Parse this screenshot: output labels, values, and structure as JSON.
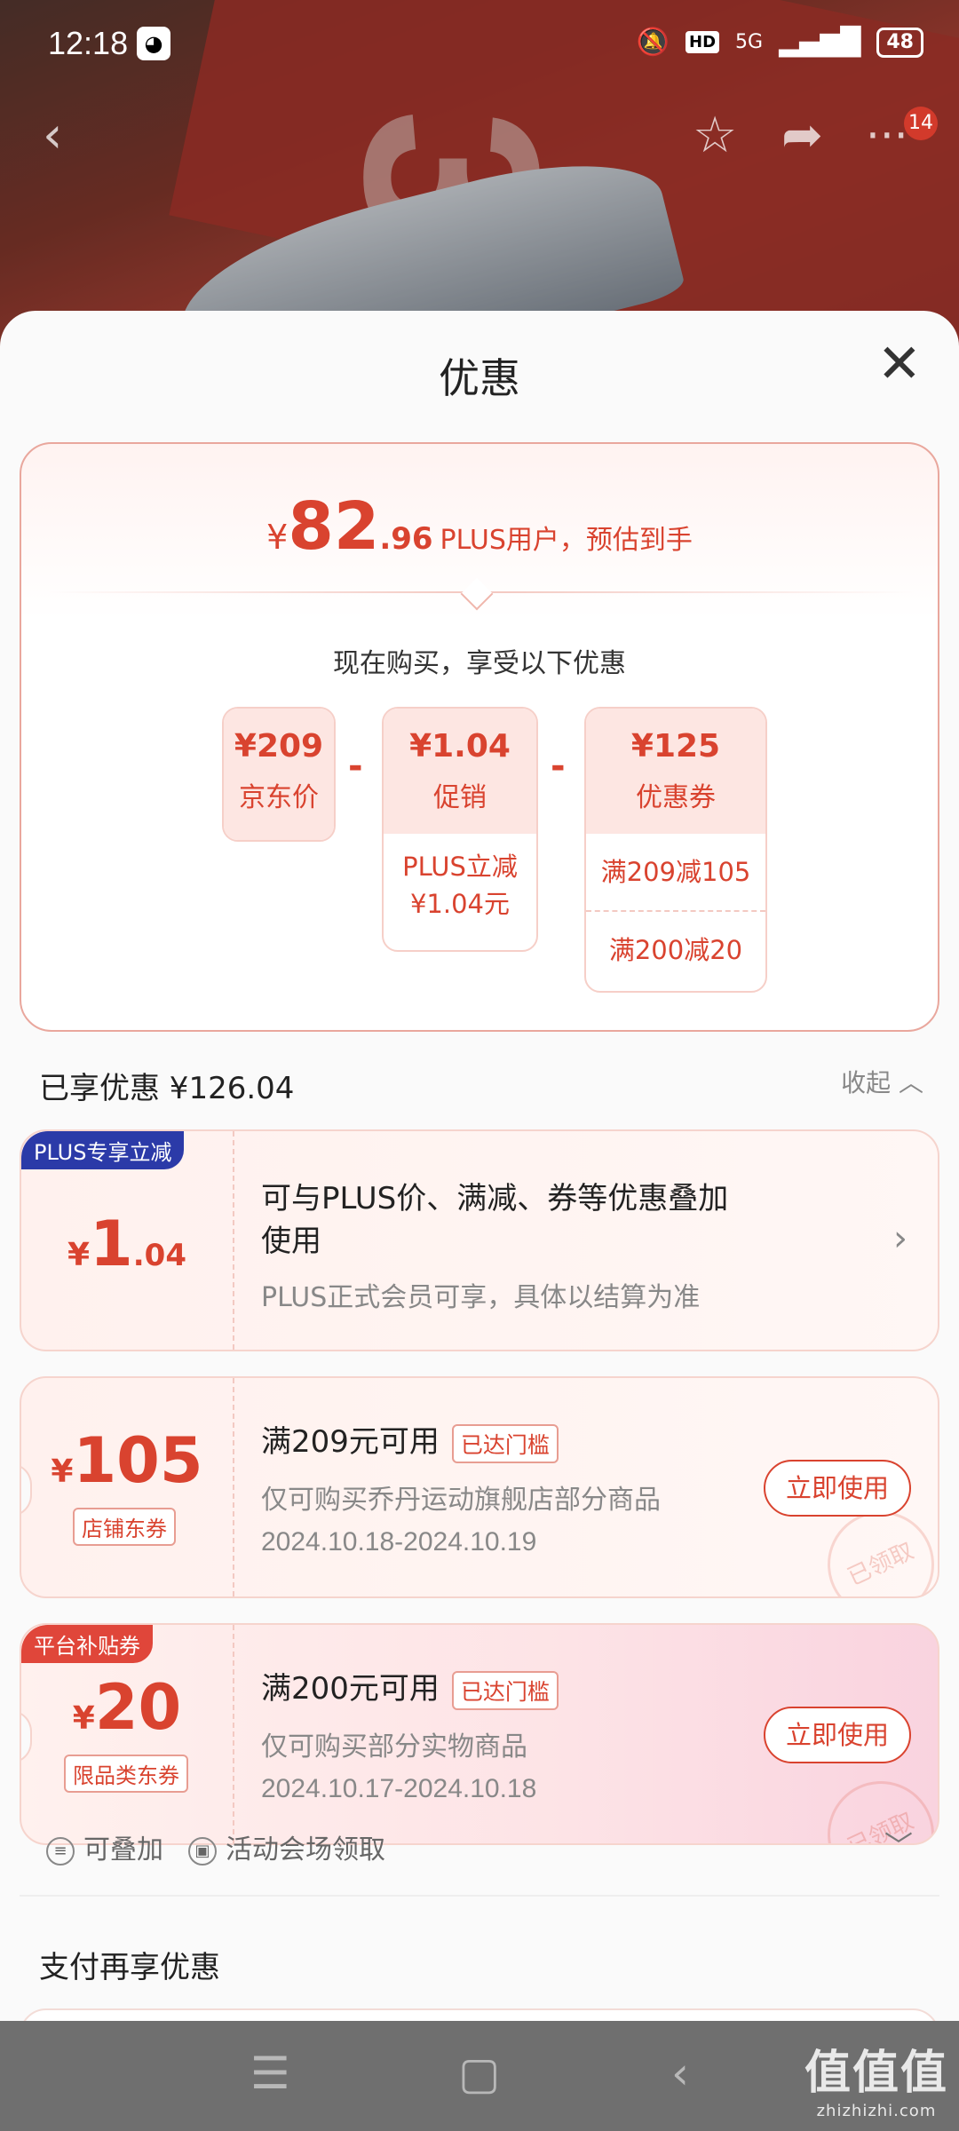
{
  "status_bar": {
    "time": "12:18",
    "hd": "HD",
    "network": "5G",
    "battery": "48"
  },
  "nav": {
    "badge": "14"
  },
  "sheet": {
    "title": "优惠"
  },
  "summary": {
    "yen": "¥",
    "price_int": "82",
    "price_dec": ".96",
    "note": "PLUS用户，预估到手",
    "subtitle": "现在购买，享受以下优惠",
    "jd_price": {
      "price": "¥209",
      "label": "京东价"
    },
    "promo": {
      "price": "¥1.04",
      "label": "促销",
      "detail_line1": "PLUS立减",
      "detail_line2": "¥1.04元"
    },
    "coupon": {
      "price": "¥125",
      "label": "优惠券",
      "rows": [
        "满209减105",
        "满200减20"
      ]
    },
    "op1": "-",
    "op2": "-"
  },
  "enjoyed": {
    "text": "已享优惠 ¥126.04",
    "collapse": "收起"
  },
  "coupons": [
    {
      "corner_tag": "PLUS专享立减",
      "yen": "¥",
      "amount": "1",
      "amount_dec": ".04",
      "title_line1": "可与PLUS价、满减、券等优惠叠加",
      "title_line2": "使用",
      "sub": "PLUS正式会员可享，具体以结算为准"
    },
    {
      "yen": "¥",
      "amount": "105",
      "tag": "店铺东券",
      "title": "满209元可用",
      "badge": "已达门槛",
      "sub": "仅可购买乔丹运动旗舰店部分商品",
      "date": "2024.10.18-2024.10.19",
      "button": "立即使用",
      "stamp": "已领取"
    },
    {
      "corner_tag": "平台补贴券",
      "yen": "¥",
      "amount": "20",
      "tag": "限品类东券",
      "title": "满200元可用",
      "badge": "已达门槛",
      "sub": "仅可购买部分实物商品",
      "date": "2024.10.17-2024.10.18",
      "button": "立即使用",
      "stamp": "已领取"
    }
  ],
  "extra": {
    "stackable": "可叠加",
    "venue": "活动会场领取"
  },
  "pay": {
    "title": "支付再享优惠"
  },
  "watermark": {
    "main": "值值值",
    "sub": "zhizhizhi.com"
  },
  "colors": {
    "accent": "#d9432f",
    "plus_tag": "#2b3aa8",
    "platform_tag": "#e0463a"
  }
}
